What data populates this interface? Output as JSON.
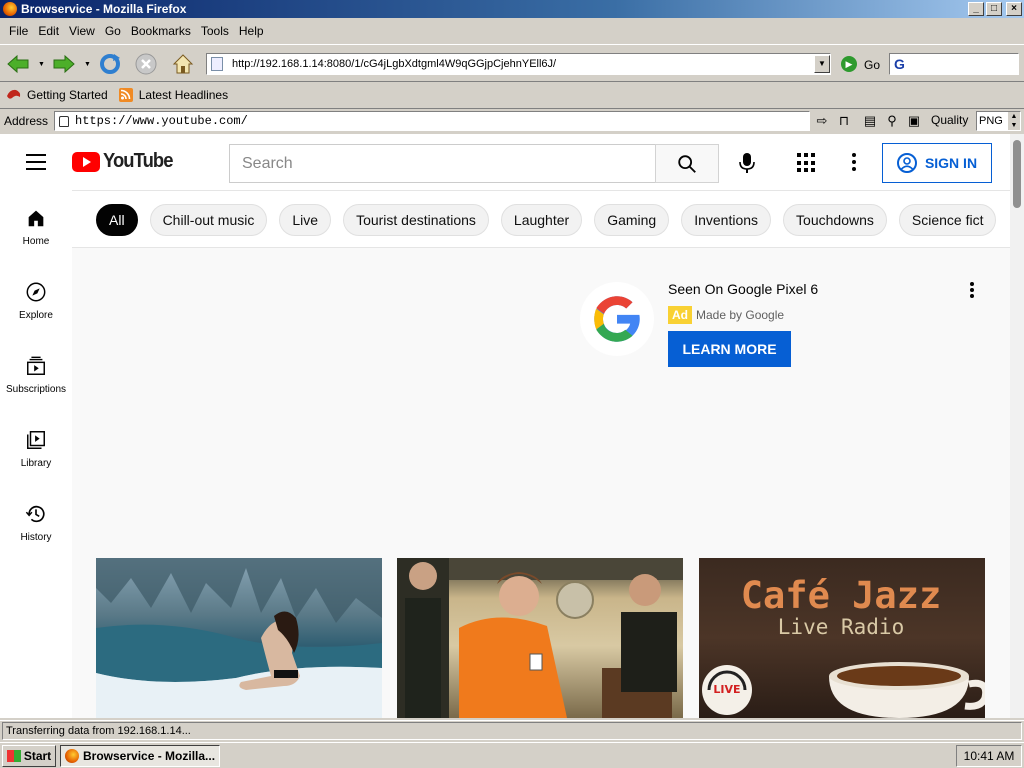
{
  "window": {
    "title": "Browservice - Mozilla Firefox",
    "buttons": {
      "minimize": "_",
      "maximize": "□",
      "close": "×"
    }
  },
  "menu": {
    "items": [
      "File",
      "Edit",
      "View",
      "Go",
      "Bookmarks",
      "Tools",
      "Help"
    ]
  },
  "navbar": {
    "url": "http://192.168.1.14:8080/1/cG4jLgbXdtgml4W9qGGjpCjehnYEll6J/",
    "go_label": "Go",
    "search_glyph": "G"
  },
  "bookmarks": {
    "items": [
      "Getting Started",
      "Latest Headlines"
    ]
  },
  "address_bar": {
    "label": "Address",
    "url": "https://www.youtube.com/",
    "quality_label": "Quality",
    "quality_value": "PNG"
  },
  "youtube": {
    "logo_text": "YouTube",
    "search_placeholder": "Search",
    "sign_in": "SIGN IN",
    "chips": [
      "All",
      "Chill-out music",
      "Live",
      "Tourist destinations",
      "Laughter",
      "Gaming",
      "Inventions",
      "Touchdowns",
      "Science fict"
    ],
    "guide": [
      "Home",
      "Explore",
      "Subscriptions",
      "Library",
      "History"
    ],
    "ad": {
      "title": "Seen On Google Pixel 6",
      "badge": "Ad",
      "sponsor": "Made by Google",
      "cta": "LEARN MORE"
    },
    "thumbnails": {
      "third": {
        "line1": "Café Jazz",
        "line2": "Live Radio",
        "badge": "LIVE"
      }
    }
  },
  "status": {
    "text": "Transferring data from 192.168.1.14..."
  },
  "taskbar": {
    "start": "Start",
    "task": "Browservice - Mozilla...",
    "clock": "10:41 AM"
  },
  "colors": {
    "yt_red": "#ff0000",
    "yt_blue": "#065fd4",
    "ad_yellow": "#f9d133",
    "win_face": "#d4d0c8"
  }
}
